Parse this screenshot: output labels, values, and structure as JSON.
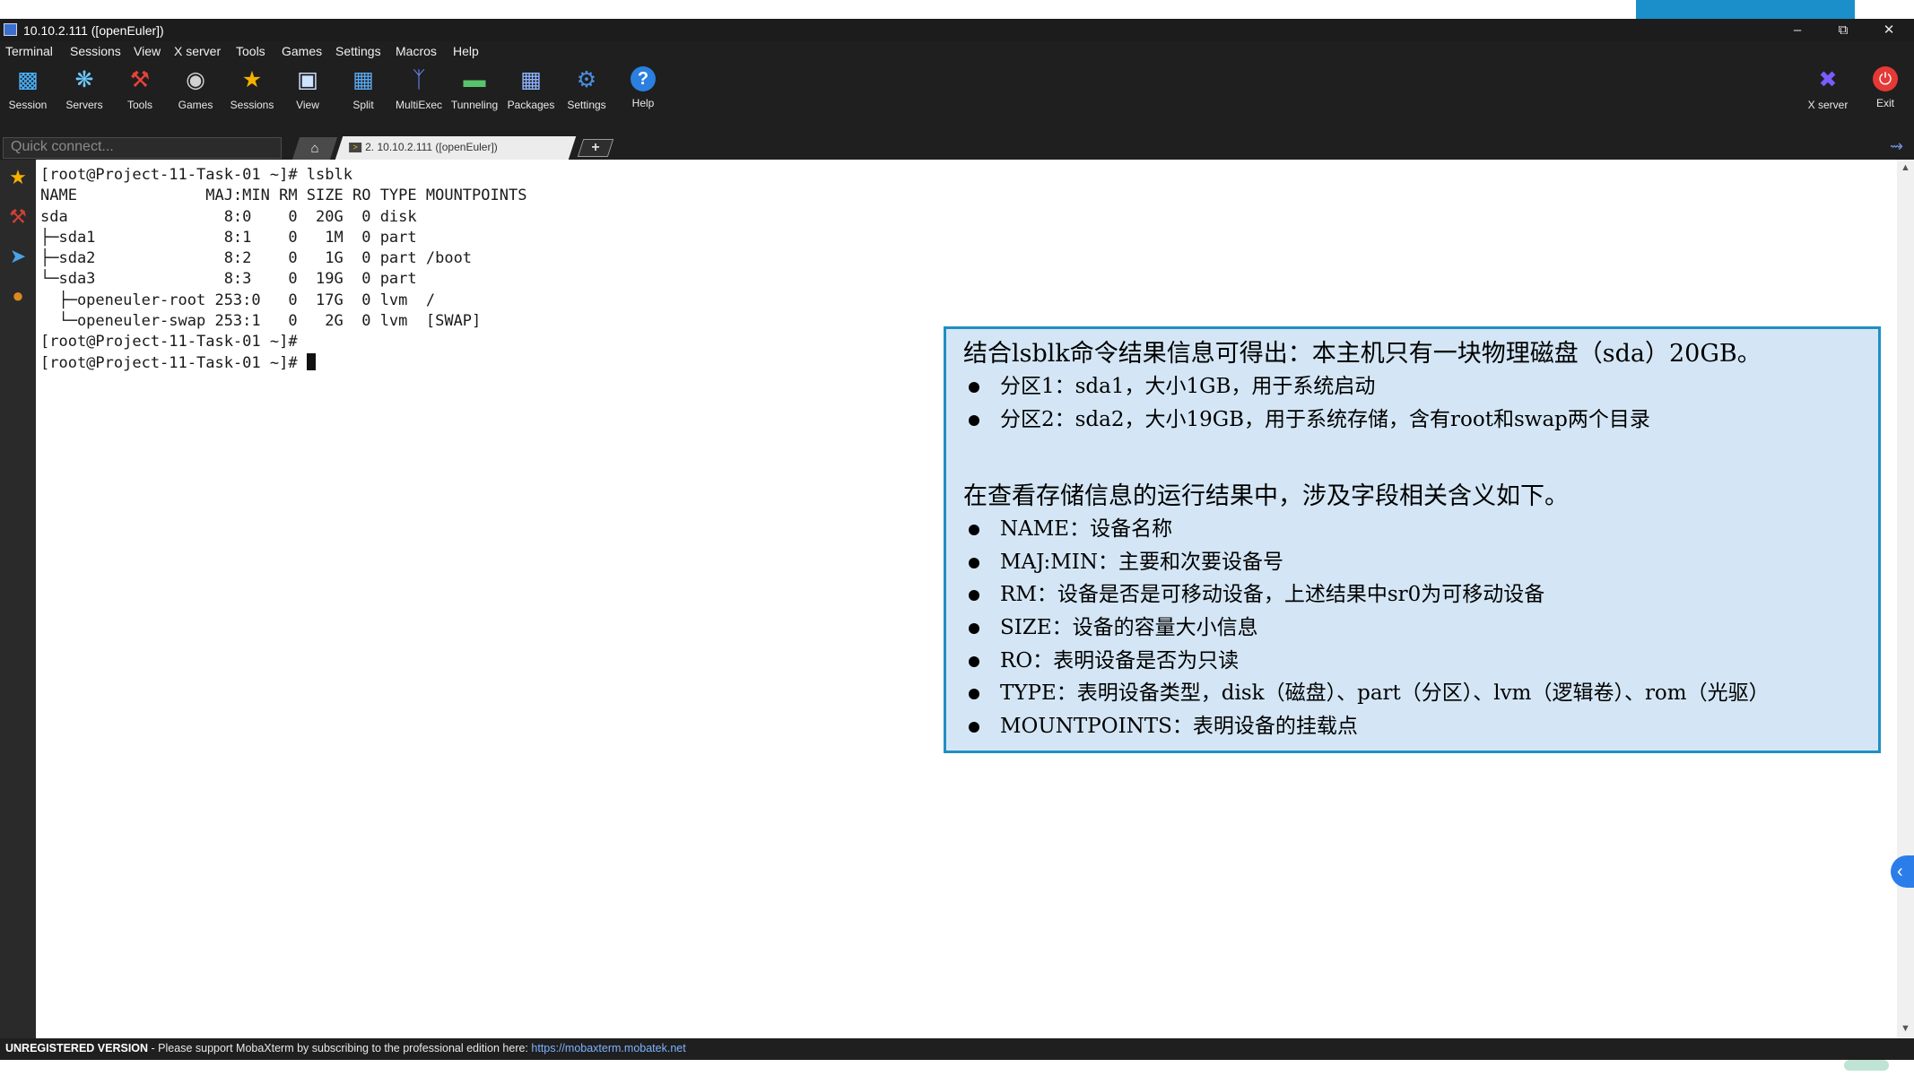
{
  "window": {
    "title": "10.10.2.111 ([openEuler])"
  },
  "menu": [
    "Terminal",
    "Sessions",
    "View",
    "X server",
    "Tools",
    "Games",
    "Settings",
    "Macros",
    "Help"
  ],
  "toolbar": {
    "session": "Session",
    "servers": "Servers",
    "tools": "Tools",
    "games": "Games",
    "sessions": "Sessions",
    "view": "View",
    "split": "Split",
    "multiexec": "MultiExec",
    "tunneling": "Tunneling",
    "packages": "Packages",
    "settings": "Settings",
    "help": "Help",
    "xserver": "X server",
    "exit": "Exit"
  },
  "tabs": {
    "quick_connect_placeholder": "Quick connect...",
    "session_tab": "2. 10.10.2.111 ([openEuler])"
  },
  "terminal": {
    "lines": [
      "[root@Project-11-Task-01 ~]# lsblk",
      "NAME              MAJ:MIN RM SIZE RO TYPE MOUNTPOINTS",
      "sda                 8:0    0  20G  0 disk",
      "├─sda1              8:1    0   1M  0 part",
      "├─sda2              8:2    0   1G  0 part /boot",
      "└─sda3              8:3    0  19G  0 part",
      "  ├─openeuler-root 253:0   0  17G  0 lvm  /",
      "  └─openeuler-swap 253:1   0   2G  0 lvm  [SWAP]",
      "[root@Project-11-Task-01 ~]#"
    ],
    "prompt": "[root@Project-11-Task-01 ~]# "
  },
  "status": {
    "unregistered": "UNREGISTERED VERSION",
    "message": "  -  Please support MobaXterm by subscribing to the professional edition here: ",
    "link": "https://mobaxterm.mobatek.net"
  },
  "info": {
    "heading1": "结合lsblk命令结果信息可得出：本主机只有一块物理磁盘（sda）20GB。",
    "partitions": [
      "分区1：sda1，大小1GB，用于系统启动",
      "分区2：sda2，大小19GB，用于系统存储，含有root和swap两个目录"
    ],
    "heading2": "在查看存储信息的运行结果中，涉及字段相关含义如下。",
    "fields": [
      "NAME：设备名称",
      "MAJ:MIN：主要和次要设备号",
      "RM：设备是否是可移动设备，上述结果中sr0为可移动设备",
      "SIZE：设备的容量大小信息",
      "RO：表明设备是否为只读",
      "TYPE：表明设备类型，disk（磁盘）、part（分区）、lvm（逻辑卷）、rom（光驱）",
      "MOUNTPOINTS：表明设备的挂载点"
    ]
  },
  "icons": {
    "session": "monitor-icon",
    "servers": "servers-icon",
    "tools": "tools-icon",
    "games": "gamepad-icon",
    "sessions": "star-icon",
    "view": "view-icon",
    "split": "split-icon",
    "multiexec": "multiexec-icon",
    "tunneling": "tunneling-icon",
    "packages": "packages-icon",
    "settings": "gear-icon",
    "help": "help-icon",
    "xserver": "x-server-icon",
    "exit": "power-icon"
  },
  "colors": {
    "window_bg": "#1f1f1f",
    "terminal_bg": "#ffffff",
    "info_box_bg": "#d4e6f5",
    "info_box_border": "#1f8fc4",
    "link": "#7fb2ff"
  }
}
